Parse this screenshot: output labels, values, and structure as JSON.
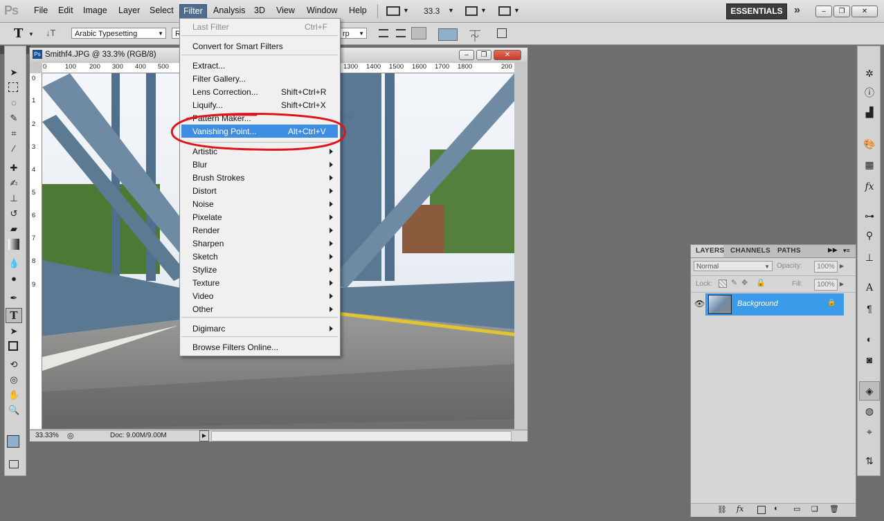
{
  "menubar": {
    "logo": "Ps",
    "items": [
      "File",
      "Edit",
      "Image",
      "Layer",
      "Select",
      "Filter",
      "Analysis",
      "3D",
      "View",
      "Window",
      "Help"
    ],
    "zoom": "33.3",
    "workspace": "ESSENTIALS"
  },
  "options": {
    "text_tool": "T",
    "font_family": "Arabic Typesetting",
    "font_style": "R",
    "antialias": "rp"
  },
  "document": {
    "title": "Smithf4.JPG @ 33.3% (RGB/8)",
    "ruler_top": [
      "0",
      "100",
      "200",
      "300",
      "400",
      "500",
      "1300",
      "1400",
      "1500",
      "1600",
      "1700",
      "1800",
      "200"
    ],
    "ruler_left": [
      "0",
      "1",
      "2",
      "3",
      "4",
      "5",
      "6",
      "7",
      "8",
      "9"
    ],
    "zoom": "33.33%",
    "doc_size": "Doc: 9.00M/9.00M"
  },
  "filter_menu": {
    "last_filter": "Last Filter",
    "last_filter_sc": "Ctrl+F",
    "convert": "Convert for Smart Filters",
    "extract": "Extract...",
    "gallery": "Filter Gallery...",
    "lens": "Lens Correction...",
    "lens_sc": "Shift+Ctrl+R",
    "liquify": "Liquify...",
    "liquify_sc": "Shift+Ctrl+X",
    "pattern": "Pattern Maker...",
    "vanishing": "Vanishing Point...",
    "vanishing_sc": "Alt+Ctrl+V",
    "submenus": [
      "Artistic",
      "Blur",
      "Brush Strokes",
      "Distort",
      "Noise",
      "Pixelate",
      "Render",
      "Sharpen",
      "Sketch",
      "Stylize",
      "Texture",
      "Video",
      "Other"
    ],
    "digimarc": "Digimarc",
    "browse": "Browse Filters Online..."
  },
  "layers_panel": {
    "tabs": [
      "LAYERS",
      "CHANNELS",
      "PATHS"
    ],
    "blend_mode": "Normal",
    "opacity_label": "Opacity:",
    "opacity": "100%",
    "lock_label": "Lock:",
    "fill_label": "Fill:",
    "fill": "100%",
    "layer_name": "Background"
  },
  "colors": {
    "menu_highlight": "#3d8ee3",
    "annotation": "#e0151b",
    "foreground": "#8fb0cc"
  }
}
